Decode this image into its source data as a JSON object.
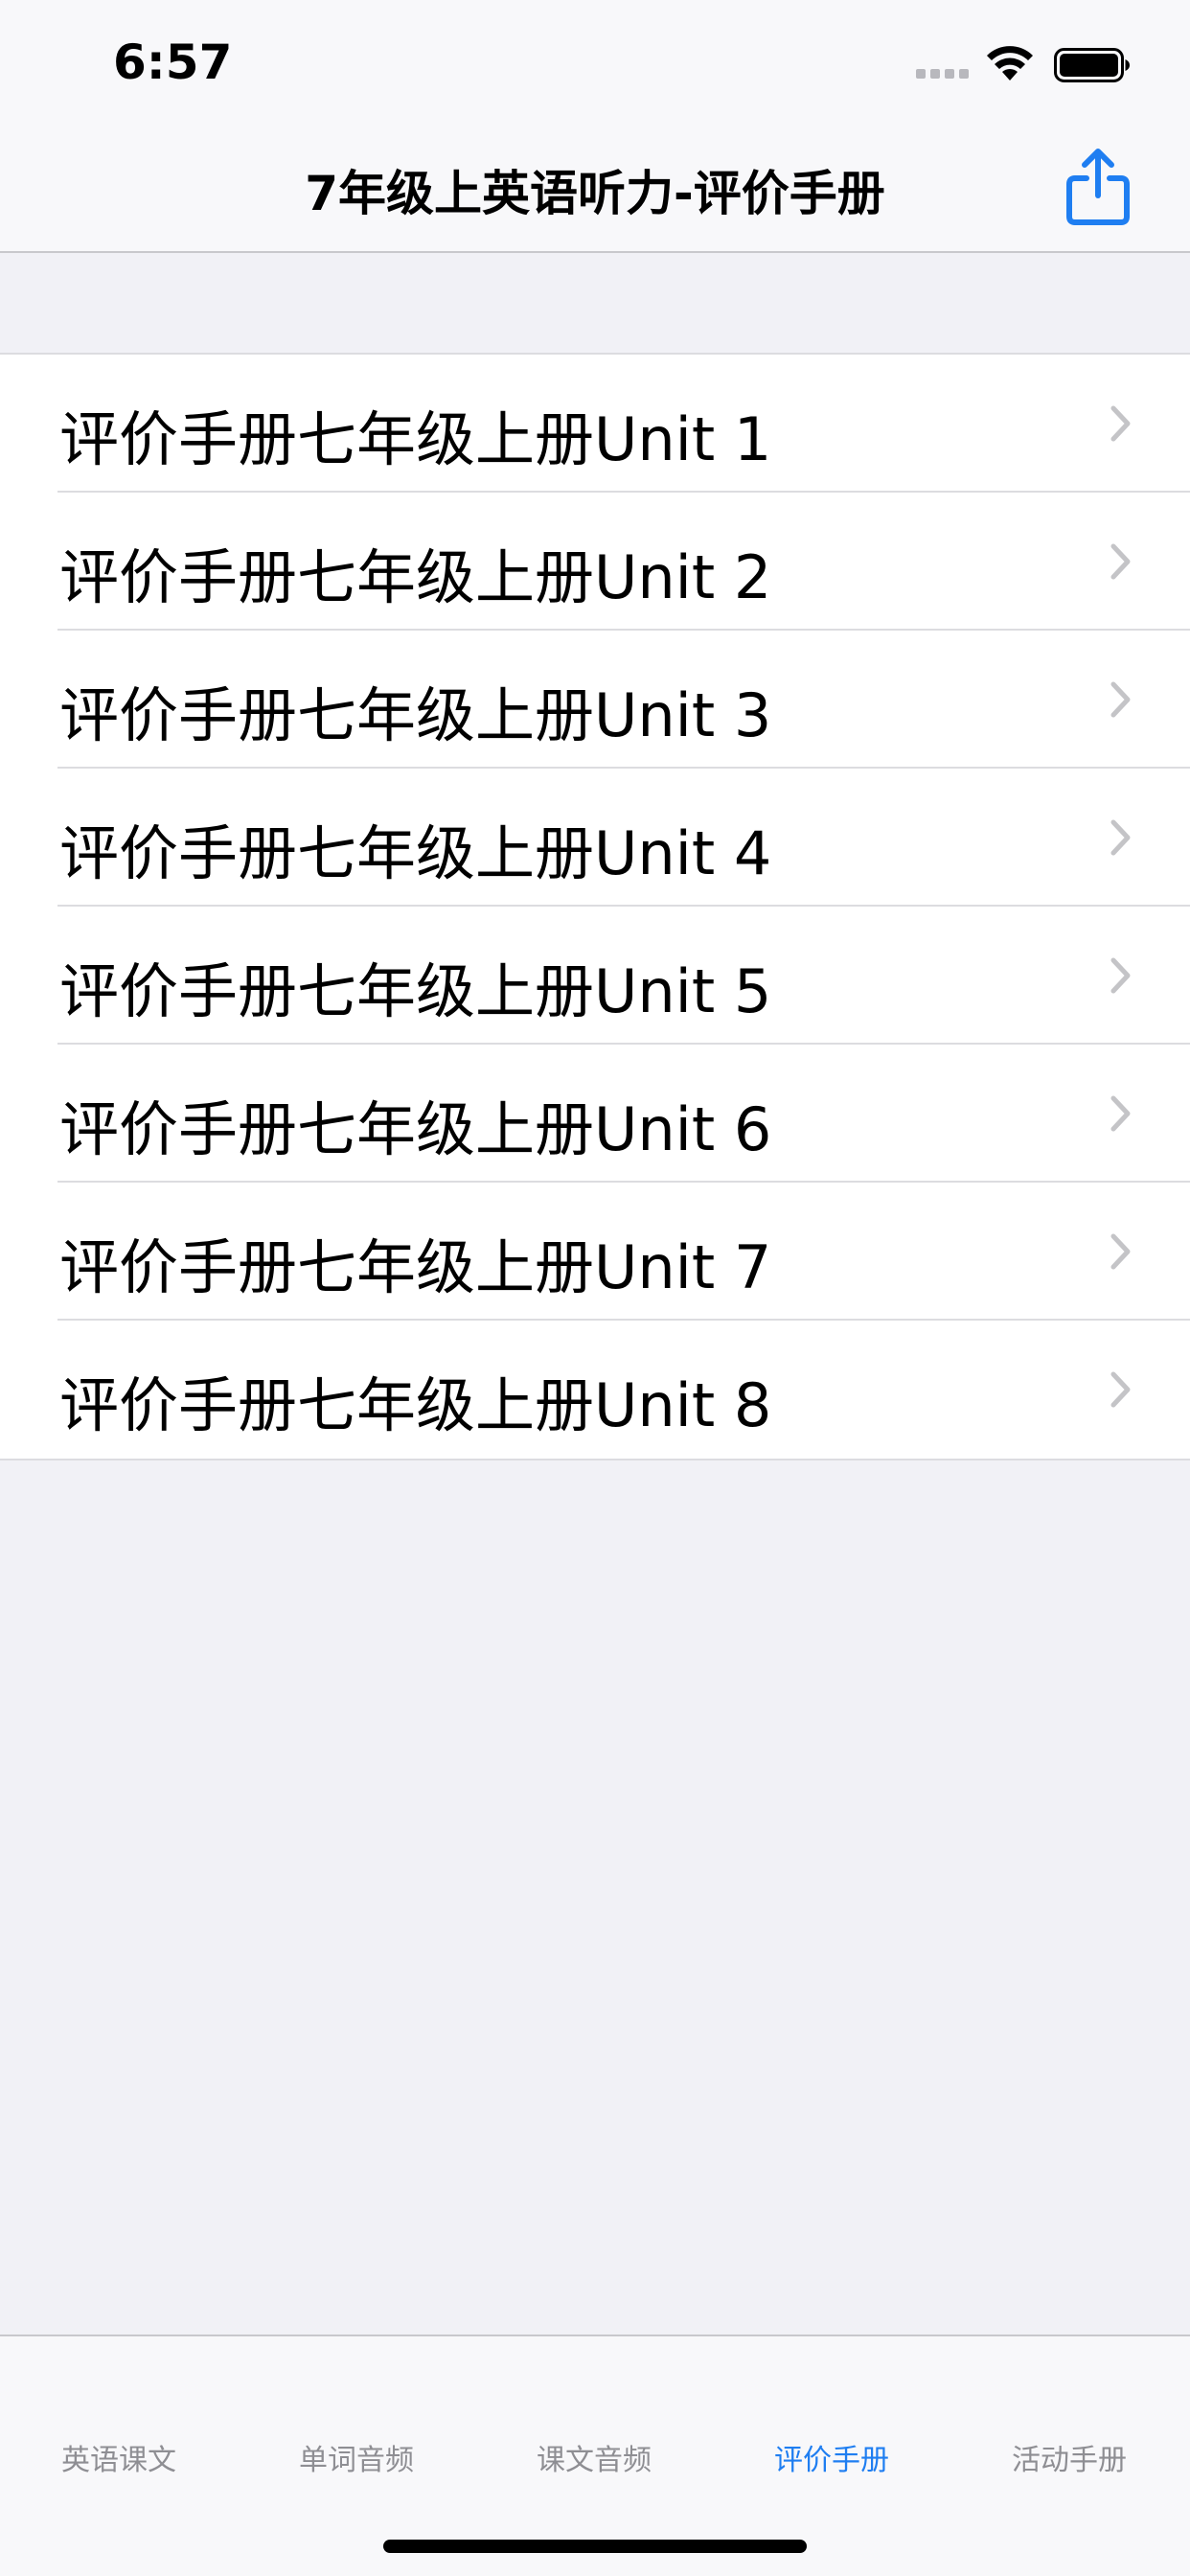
{
  "status_bar": {
    "time": "6:57"
  },
  "nav": {
    "title": "7年级上英语听力-评价手册",
    "share_icon": "share-icon",
    "accent_color": "#1f7ef1"
  },
  "list": {
    "items": [
      {
        "label": "评价手册七年级上册Unit 1"
      },
      {
        "label": "评价手册七年级上册Unit 2"
      },
      {
        "label": "评价手册七年级上册Unit 3"
      },
      {
        "label": "评价手册七年级上册Unit 4"
      },
      {
        "label": "评价手册七年级上册Unit 5"
      },
      {
        "label": "评价手册七年级上册Unit 6"
      },
      {
        "label": "评价手册七年级上册Unit 7"
      },
      {
        "label": "评价手册七年级上册Unit 8"
      }
    ]
  },
  "tab_bar": {
    "active_index": 3,
    "tabs": [
      {
        "label": "英语课文"
      },
      {
        "label": "单词音频"
      },
      {
        "label": "课文音频"
      },
      {
        "label": "评价手册"
      },
      {
        "label": "活动手册"
      }
    ]
  }
}
